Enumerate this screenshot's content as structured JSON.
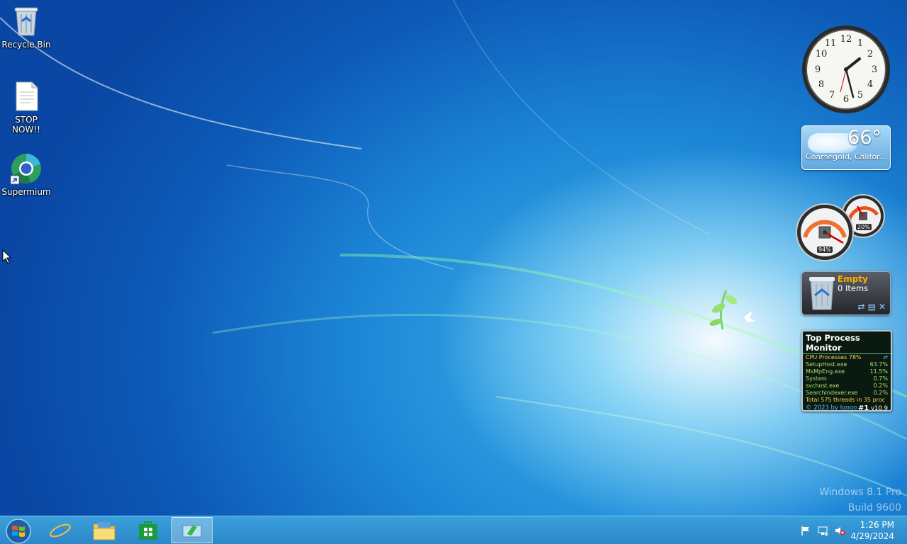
{
  "desktop": {
    "icons": [
      {
        "label": "Recycle Bin",
        "icon": "recycle-bin-icon"
      },
      {
        "label": "STOP NOW!!",
        "icon": "text-document-icon"
      },
      {
        "label": "Supermium",
        "icon": "supermium-browser-icon"
      }
    ],
    "watermark": {
      "line1": "Windows 8.1 Pro",
      "line2": "Build 9600"
    }
  },
  "gadgets": {
    "clock": {
      "time": "1:26"
    },
    "weather": {
      "temperature": "66°",
      "location": "Coarsegold, Califor..."
    },
    "cpu_meter": {
      "cpu": "94%",
      "memory": "20%"
    },
    "recycle_bin": {
      "status": "Empty",
      "items": "0 Items"
    },
    "top_process_monitor": {
      "title": "Top Process Monitor",
      "cpu_label": "CPU Processes 78%",
      "processes": [
        {
          "name": "SetupHost.exe",
          "value": "63.7%"
        },
        {
          "name": "MsMpEng.exe",
          "value": "11.5%"
        },
        {
          "name": "System",
          "value": "0.7%"
        },
        {
          "name": "svchost.exe",
          "value": "0.2%"
        },
        {
          "name": "SearchIndexer.exe",
          "value": "0.2%"
        }
      ],
      "total": "Total 575 threads in 35 proc",
      "credit": "© 2023 by Igogo",
      "rank": "#1",
      "version": "v10.9"
    }
  },
  "taskbar": {
    "items": [
      "start-button",
      "internet-explorer",
      "file-explorer",
      "store",
      "active-app"
    ],
    "time": "1:26 PM",
    "date": "4/29/2024"
  },
  "colors": {
    "taskbar": "#2b86c8",
    "accent_orange": "#ffb000"
  }
}
